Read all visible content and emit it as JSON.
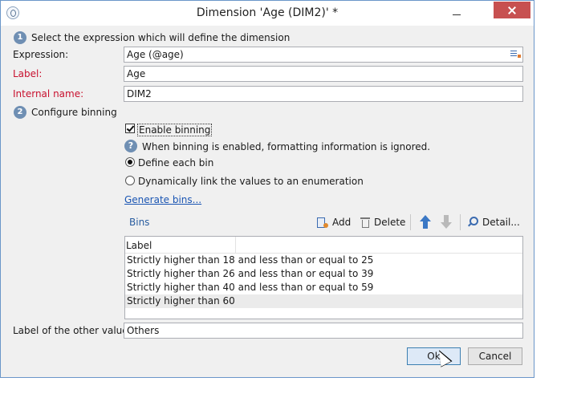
{
  "window": {
    "title": "Dimension 'Age (DIM2)' *"
  },
  "section1": {
    "number": "1",
    "heading": "Select the expression which will define the dimension",
    "expression_label": "Expression:",
    "expression_value": "Age (@age)",
    "label_label": "Label:",
    "label_value": "Age",
    "internal_name_label": "Internal name:",
    "internal_name_value": "DIM2"
  },
  "section2": {
    "number": "2",
    "heading": "Configure binning",
    "enable_binning_label": "Enable binning",
    "enable_binning_checked": true,
    "info_text": "When binning is enabled, formatting information is ignored.",
    "radio_define_each_bin": "Define each bin",
    "radio_dynamic_link": "Dynamically link the values to an enumeration",
    "selected_radio": "define_each_bin",
    "generate_bins_link": "Generate bins..."
  },
  "bins_toolbar": {
    "title": "Bins",
    "add_label": "Add",
    "delete_label": "Delete",
    "detail_label": "Detail..."
  },
  "bins_grid": {
    "column_label": "Label",
    "rows": [
      "Strictly higher than 18 and less than or equal to 25",
      "Strictly higher than 26 and less than or equal to 39",
      "Strictly higher than 40 and less than or equal to 59",
      "Strictly higher than 60"
    ],
    "selected_row_index": 3
  },
  "other_values": {
    "label": "Label of the other values:",
    "value": "Others"
  },
  "buttons": {
    "ok": "Ok",
    "cancel": "Cancel"
  },
  "colors": {
    "accent": "#3c7fb1",
    "required_label": "#c8102e",
    "link": "#1a55b3",
    "close_button": "#c75050"
  }
}
